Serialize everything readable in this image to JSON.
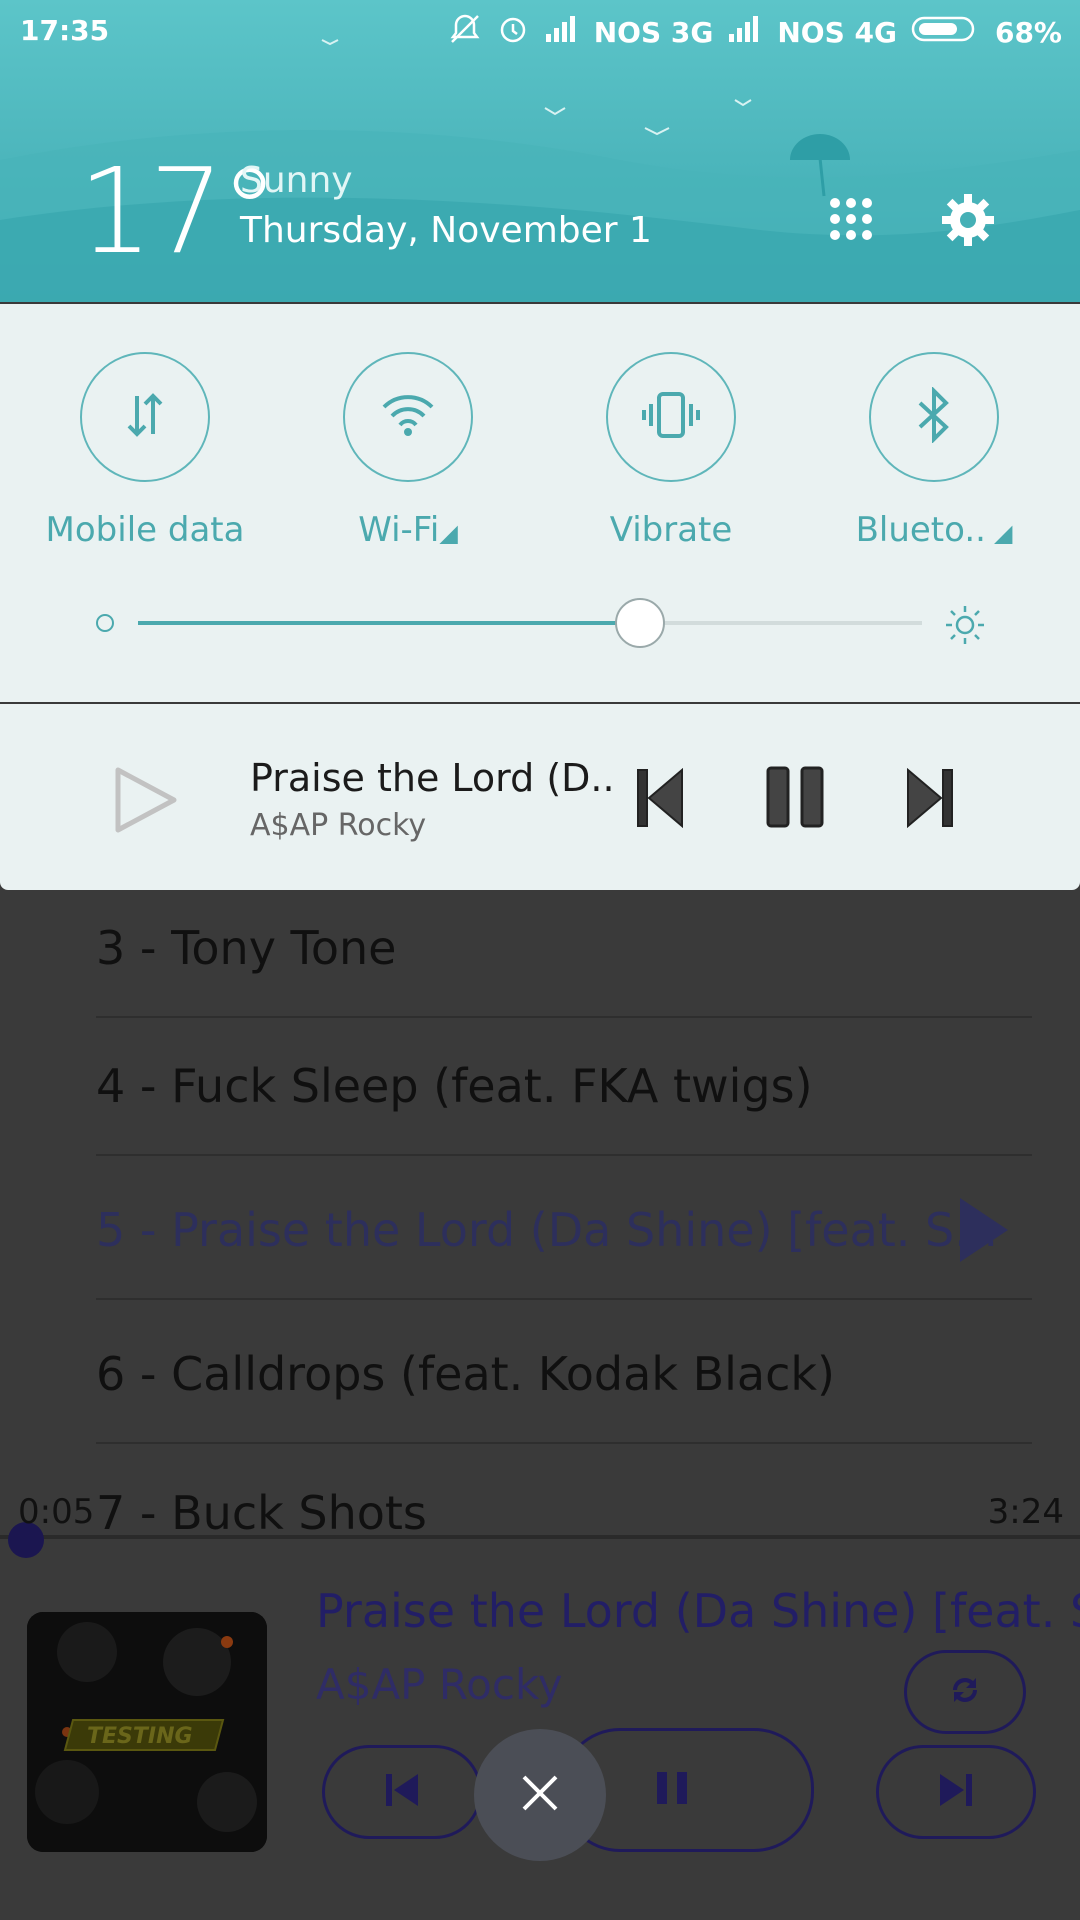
{
  "status_bar": {
    "time": "17:35",
    "carrier1": "NOS 3G",
    "carrier2": "NOS 4G",
    "battery": "68%"
  },
  "weather": {
    "temperature": "17°",
    "condition": "Sunny",
    "date": "Thursday, November 1"
  },
  "quick_toggles": [
    {
      "label": "Mobile data",
      "icon": "mobile-data-icon"
    },
    {
      "label": "Wi-Fi",
      "icon": "wifi-icon"
    },
    {
      "label": "Vibrate",
      "icon": "vibrate-icon"
    },
    {
      "label": "Blueto..",
      "icon": "bluetooth-icon"
    }
  ],
  "brightness": {
    "level": 0.64
  },
  "media_notification": {
    "title": "Praise the Lord (D..",
    "artist": "A$AP Rocky"
  },
  "tracklist": [
    {
      "text": "3 - Tony Tone"
    },
    {
      "text": "4 - Fuck Sleep (feat. FKA twigs)"
    },
    {
      "text": "5 - Praise the Lord (Da Shine) [feat. S..."
    },
    {
      "text": "6 - Calldrops (feat. Kodak Black)"
    },
    {
      "text": "7 - Buck Shots"
    }
  ],
  "player": {
    "elapsed": "0:05",
    "duration": "3:24",
    "title": "Praise the Lord (Da Shine) [feat. S",
    "artist": "A$AP Rocky",
    "album_text": "TESTING"
  },
  "colors": {
    "shade_accent": "#4ba9ae",
    "header_top": "#5cc5c9",
    "player_accent": "#221e66"
  }
}
